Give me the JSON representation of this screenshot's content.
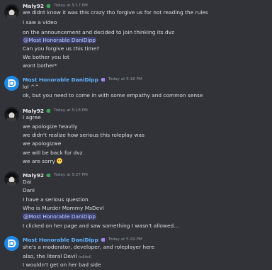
{
  "colors": {
    "background": "#313338",
    "user_maly": "#e8e8e8",
    "user_dani": "#5eb3ff",
    "timestamp": "#949ba4",
    "mention_bg": "#3c4270",
    "mention_text": "#c9cdfb"
  },
  "messages": [
    {
      "user": "Maly92",
      "badge": "green-tag-icon",
      "time": "Today at 5:17 PM",
      "lines": [
        "we didnt know it was this crazy tho forgive us for not reading the rules",
        "I saw a video",
        "on the announcement and decided to join thinking its dvz",
        "@Most Honorable DaniDipp",
        "Can you forgive us this time?",
        "We bother you lot",
        "wont bother*"
      ]
    },
    {
      "user": "Most Honorable DaniDipp",
      "badge": "purple-tag-icon",
      "time": "Today at 5:18 PM",
      "lines": [
        "lol ^^",
        "ok, but you need to come in with some empathy and common sense"
      ]
    },
    {
      "user": "Maly92",
      "badge": "green-tag-icon",
      "time": "Today at 5:18 PM",
      "lines": [
        "I agree",
        "we apologize heavily",
        "we didn't realize how serious this roleplay was",
        "we apologizwe",
        "we will be back for dvz",
        "we are sorry"
      ],
      "emoji": "slightly-frowning-face-emoji"
    },
    {
      "user": "Maly92",
      "badge": "green-tag-icon",
      "time": "Today at 5:27 PM",
      "lines": [
        "Dai",
        "Dani",
        "I have a serious question",
        "Who is Murder Mommy MsDevl",
        "@Most Honorable DaniDipp",
        "I clicked on her page and saw something I wasn't allowed..."
      ]
    },
    {
      "user": "Most Honorable DaniDipp",
      "badge": "purple-tag-icon",
      "time": "Today at 5:29 PM",
      "lines": [
        "she's a moderator, developer, and roleplayer here",
        "also, the literal Devil",
        "I wouldn't get on her bad side"
      ],
      "edited_label": "(edited)"
    }
  ]
}
